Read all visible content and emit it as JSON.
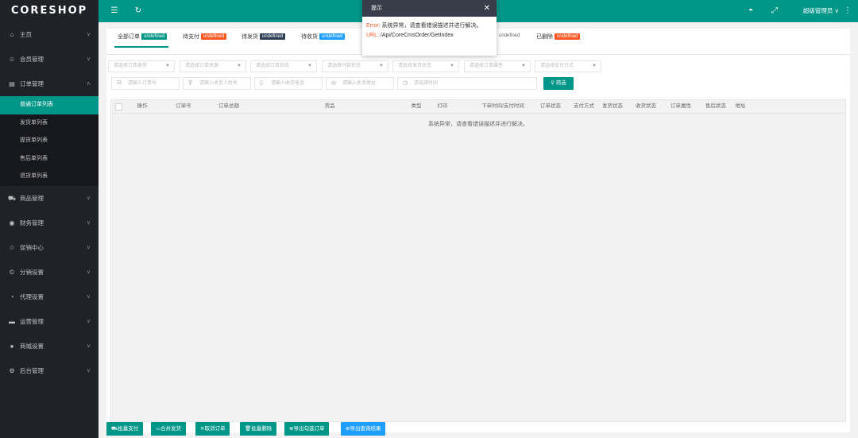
{
  "app": {
    "logo": "CORESHOP"
  },
  "header": {
    "menu_icon": "hamburger-icon",
    "refresh_icon": "refresh-icon",
    "theme_icon": "theme-icon",
    "fullscreen_icon": "fullscreen-icon",
    "user_label": "超级管理员 ∨",
    "more_icon": "more-vertical-icon"
  },
  "sidebar": {
    "items": [
      {
        "label": "主页",
        "icon": "home-icon",
        "chev": "∨"
      },
      {
        "label": "会员管理",
        "icon": "user-icon",
        "chev": "∨"
      },
      {
        "label": "订单管理",
        "icon": "order-icon",
        "chev": "∧"
      },
      {
        "label": "商品管理",
        "icon": "cart-icon",
        "chev": "∨"
      },
      {
        "label": "财务管理",
        "icon": "finance-icon",
        "chev": "∨"
      },
      {
        "label": "促销中心",
        "icon": "star-icon",
        "chev": "∨"
      },
      {
        "label": "分销设置",
        "icon": "distribution-icon",
        "chev": "∨"
      },
      {
        "label": "代理设置",
        "icon": "agent-icon",
        "chev": "∨"
      },
      {
        "label": "运营管理",
        "icon": "operation-icon",
        "chev": "∨"
      },
      {
        "label": "商城设置",
        "icon": "mall-icon",
        "chev": "∨"
      },
      {
        "label": "后台管理",
        "icon": "settings-icon",
        "chev": "∨"
      }
    ],
    "submenu": [
      {
        "label": "普通订单列表",
        "active": true
      },
      {
        "label": "发货单列表"
      },
      {
        "label": "提货单列表"
      },
      {
        "label": "售后单列表"
      },
      {
        "label": "退货单列表"
      }
    ]
  },
  "tabs": [
    {
      "label": "全部订单",
      "badge": "undefined",
      "badge_color": "#009688"
    },
    {
      "label": "待支付",
      "badge": "undefined",
      "badge_color": "#ff5722"
    },
    {
      "label": "待发货",
      "badge": "undefined",
      "badge_color": "#2f4056"
    },
    {
      "label": "待收货",
      "badge": "undefined",
      "badge_color": "#1e9fff"
    },
    {
      "label": "",
      "badge": "undefined",
      "badge_color": ""
    },
    {
      "label": "已删除",
      "badge": "undefined",
      "badge_color": "#ff5722"
    }
  ],
  "filters": {
    "selects": [
      "请选择订单类型",
      "请选择订单来源",
      "请选择订单状态",
      "请选择付款状态",
      "请选择发货状态",
      "请选择订单属性",
      "请选择支付方式"
    ],
    "inputs": [
      {
        "placeholder": "请输入订单号",
        "icon": "list-icon"
      },
      {
        "placeholder": "请输入收货人姓名",
        "icon": "person-icon"
      },
      {
        "placeholder": "请输入收货电话",
        "icon": "phone-icon"
      },
      {
        "placeholder": "请输入收货地址",
        "icon": "location-icon"
      },
      {
        "placeholder": "请选择时间",
        "icon": "clock-icon"
      }
    ],
    "filter_button": "筛选"
  },
  "table": {
    "columns": [
      "操作",
      "订单号",
      "订单总额",
      "货品",
      "类型",
      "打印",
      "下单时间/支付时间",
      "订单状态",
      "支付方式",
      "发货状态",
      "收货状态",
      "订单属性",
      "售后状态",
      "地址"
    ],
    "empty_message": "系统异常，请查看错误描述并进行解决。"
  },
  "actions": [
    {
      "label": "批量支付",
      "icon": "cart-icon"
    },
    {
      "label": "合并发货",
      "icon": "truck-icon"
    },
    {
      "label": "取消订单",
      "icon": "close-icon"
    },
    {
      "label": "批量删除",
      "icon": "trash-icon"
    },
    {
      "label": "导出勾选订单",
      "icon": "export-icon"
    },
    {
      "label": "导出查询结果",
      "icon": "export-icon"
    }
  ],
  "modal": {
    "title": "提示",
    "error_label": "Error:",
    "error_text": "系统异常，请查看错误描述并进行解决。",
    "url_label": "URL:",
    "url_text": "/Api/CoreCmsOrder/GetIndex"
  }
}
